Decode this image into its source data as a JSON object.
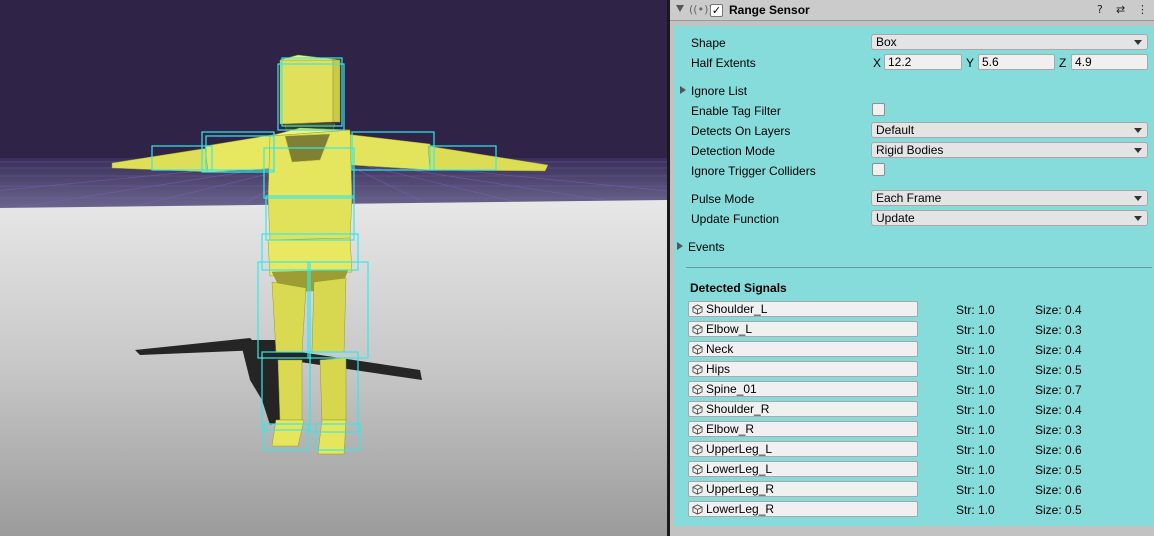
{
  "component": {
    "title": "Range Sensor",
    "enabled_mark": "✓",
    "header_icons": {
      "help": "?",
      "preset": "⇄",
      "more": "⋮"
    }
  },
  "fields": {
    "shape": {
      "label": "Shape",
      "value": "Box"
    },
    "half_extents": {
      "label": "Half Extents",
      "x_label": "X",
      "x": "12.2",
      "y_label": "Y",
      "y": "5.6",
      "z_label": "Z",
      "z": "4.9"
    },
    "ignore_list": {
      "label": "Ignore List"
    },
    "enable_tag_filter": {
      "label": "Enable Tag Filter",
      "checked": false
    },
    "detects_on_layers": {
      "label": "Detects On Layers",
      "value": "Default"
    },
    "detection_mode": {
      "label": "Detection Mode",
      "value": "Rigid Bodies"
    },
    "ignore_trigger_colliders": {
      "label": "Ignore Trigger Colliders",
      "checked": false
    },
    "pulse_mode": {
      "label": "Pulse Mode",
      "value": "Each Frame"
    },
    "update_function": {
      "label": "Update Function",
      "value": "Update"
    },
    "events": {
      "label": "Events"
    }
  },
  "detected": {
    "title": "Detected Signals",
    "str_prefix": "Str:",
    "size_prefix": "Size:",
    "signals": [
      {
        "name": "Shoulder_L",
        "str": "1.0",
        "size": "0.4"
      },
      {
        "name": "Elbow_L",
        "str": "1.0",
        "size": "0.3"
      },
      {
        "name": "Neck",
        "str": "1.0",
        "size": "0.4"
      },
      {
        "name": "Hips",
        "str": "1.0",
        "size": "0.5"
      },
      {
        "name": "Spine_01",
        "str": "1.0",
        "size": "0.7"
      },
      {
        "name": "Shoulder_R",
        "str": "1.0",
        "size": "0.4"
      },
      {
        "name": "Elbow_R",
        "str": "1.0",
        "size": "0.3"
      },
      {
        "name": "UpperLeg_L",
        "str": "1.0",
        "size": "0.6"
      },
      {
        "name": "LowerLeg_L",
        "str": "1.0",
        "size": "0.5"
      },
      {
        "name": "UpperLeg_R",
        "str": "1.0",
        "size": "0.6"
      },
      {
        "name": "LowerLeg_R",
        "str": "1.0",
        "size": "0.5"
      }
    ]
  },
  "colors": {
    "panel": "#86dbdb",
    "sky": "#2f2347",
    "character": "#e3e35a",
    "gizmo": "#35e8e8"
  }
}
